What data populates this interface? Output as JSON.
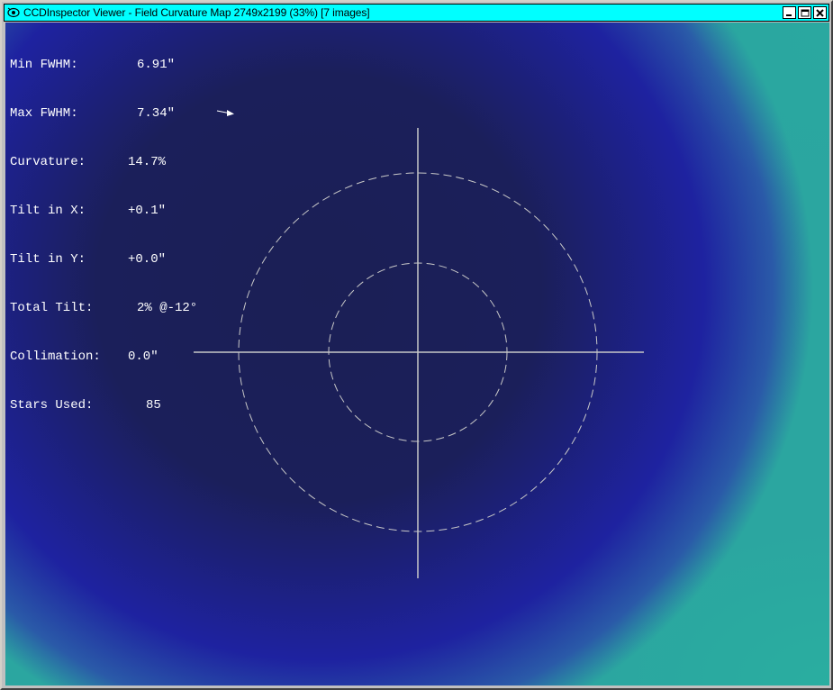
{
  "window": {
    "title": "CCDInspector Viewer - Field Curvature Map 2749x2199 (33%)  [7 images]",
    "icon": "ccdinspector-app-icon",
    "controls": [
      "minimize-icon",
      "maximize-icon",
      "close-icon"
    ]
  },
  "stats": [
    {
      "label": "Min FWHM:",
      "value": "6.91\""
    },
    {
      "label": "Max FWHM:",
      "value": "7.34\""
    },
    {
      "label": "Curvature:",
      "value": "14.7%"
    },
    {
      "label": "Tilt in X:",
      "value": "+0.1\""
    },
    {
      "label": "Tilt in Y:",
      "value": "+0.0\""
    },
    {
      "label": "Total Tilt:",
      "value": "2% @-12°"
    },
    {
      "label": "Collimation:",
      "value": "0.0\""
    },
    {
      "label": "Stars Used:",
      "value": "85"
    }
  ],
  "colors": {
    "titlebar": "#00ffff",
    "map_center": "#1b1f55",
    "map_edge": "#2ba6a0",
    "overlay_lines": "#c8c8c8"
  }
}
